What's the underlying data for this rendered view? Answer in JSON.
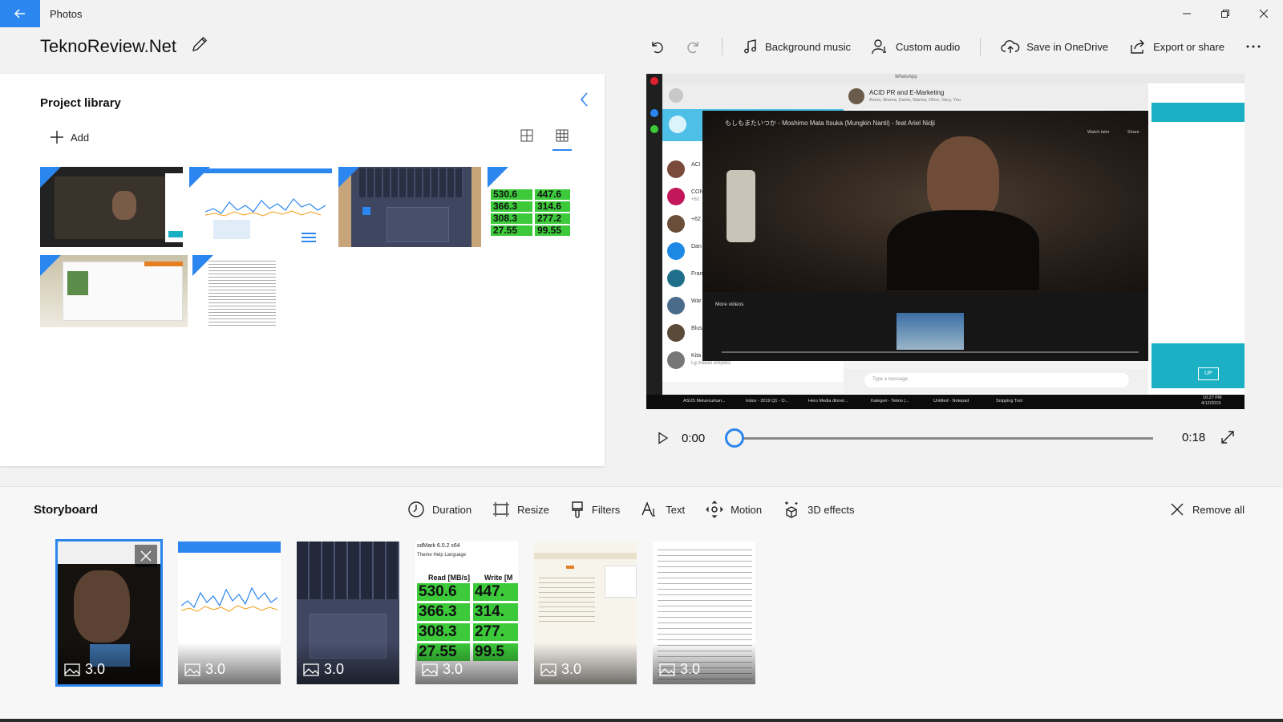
{
  "app": {
    "title": "Photos"
  },
  "project": {
    "name": "TeknoReview.Net"
  },
  "toolbar": {
    "background_music": "Background music",
    "custom_audio": "Custom audio",
    "save_onedrive": "Save in OneDrive",
    "export_share": "Export or share"
  },
  "library": {
    "title": "Project library",
    "add_label": "Add",
    "speed_thumb": [
      [
        "530.6",
        "447.6"
      ],
      [
        "366.3",
        "314.6"
      ],
      [
        "308.3",
        "277.2"
      ],
      [
        "27.55",
        "99.55"
      ]
    ]
  },
  "preview": {
    "chat_title": "ACID PR and E-Marketing",
    "chat_members": "Amna, Brama, Dama, Marisa, Oline, Vany, You",
    "video_title": "もしもまたいつか - Moshimo Mata Itsuka (Mungkin Nanti) - feat Ariel Nidji",
    "more_videos": "More videos",
    "watch_later": "Watch later",
    "share": "Share",
    "type_message": "Type a message",
    "chat_items": [
      {
        "name": "ACI",
        "sub": ""
      },
      {
        "name": "CON",
        "sub": "+62"
      },
      {
        "name": "+62",
        "sub": ""
      },
      {
        "name": "Dan",
        "sub": ""
      },
      {
        "name": "Fran",
        "sub": ""
      },
      {
        "name": "War",
        "sub": ""
      },
      {
        "name": "Blus",
        "sub": ""
      },
      {
        "name": "Kita Axis Mama",
        "sub": "Lg makan empek2"
      }
    ],
    "taskbar": [
      "ASUS Meluncurkan...",
      "Inbox - 2019 Q1 - O...",
      "Hero Media dinner...",
      "Kategori - Tekno |...",
      "Untitled - Notepad",
      "Snipping Tool"
    ],
    "clock_time": "10:27 PM",
    "clock_date": "4/12/2019",
    "up_label": "UP"
  },
  "playback": {
    "current": "0:00",
    "total": "0:18",
    "progress": 0
  },
  "storyboard": {
    "title": "Storyboard",
    "tools": {
      "duration": "Duration",
      "resize": "Resize",
      "filters": "Filters",
      "text": "Text",
      "motion": "Motion",
      "effects3d": "3D effects"
    },
    "remove_all": "Remove all",
    "clips": [
      {
        "duration": "3.0"
      },
      {
        "duration": "3.0"
      },
      {
        "duration": "3.0"
      },
      {
        "duration": "3.0"
      },
      {
        "duration": "3.0"
      },
      {
        "duration": "3.0"
      }
    ],
    "speed_clip": {
      "app": "sdMark 6.0.2 x64",
      "menu": "Theme  Help  Language",
      "read_header": "Read [MB/s]",
      "write_header": "Write [M",
      "rows": [
        [
          "530.6",
          "447."
        ],
        [
          "366.3",
          "314."
        ],
        [
          "308.3",
          "277."
        ],
        [
          "27.55",
          "99.5"
        ]
      ]
    }
  },
  "colors": {
    "accent": "#2b86f0",
    "speed_green": "#3cc93a"
  }
}
